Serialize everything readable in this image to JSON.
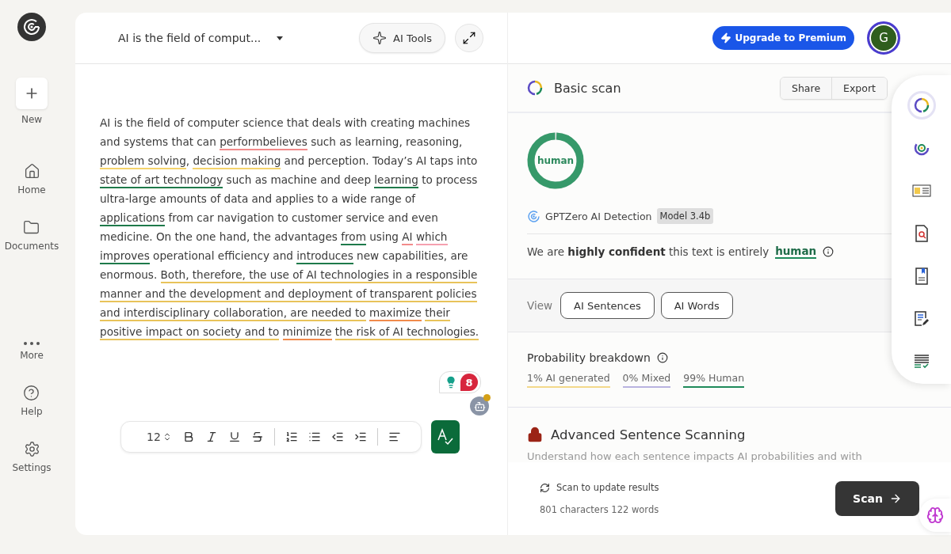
{
  "sidebar": {
    "items": [
      {
        "kind": "new",
        "label": "New"
      },
      {
        "kind": "home",
        "label": "Home"
      },
      {
        "kind": "documents",
        "label": "Documents"
      },
      {
        "kind": "more",
        "label": "More"
      },
      {
        "kind": "help",
        "label": "Help"
      },
      {
        "kind": "settings",
        "label": "Settings"
      }
    ]
  },
  "editor": {
    "title": "AI is the field of comput...",
    "ai_tools": "AI Tools",
    "segments": [
      {
        "text": "AI is the field of computer science that deals with creating machines and systems that can "
      },
      {
        "text": "performbelieves",
        "color": "#f28b8b"
      },
      {
        "text": " such as learning, reasoning, "
      },
      {
        "text": "problem solving",
        "color": "#f5d36b"
      },
      {
        "text": ", "
      },
      {
        "text": "decision making",
        "color": "#f5d36b"
      },
      {
        "text": " and perception. Today’s AI taps into "
      },
      {
        "text": "state of art technology",
        "color": "#1e7a4a"
      },
      {
        "text": " such as machine and deep "
      },
      {
        "text": "learning",
        "color": "#1e7a4a"
      },
      {
        "text": " to process ultra-large amounts of data and applies to a wide range of "
      },
      {
        "text": "applications",
        "color": "#1e7a4a"
      },
      {
        "text": " from car navigation to customer service and even medicine. On the one hand, the advantages "
      },
      {
        "text": "from",
        "color": "#1e7a4a"
      },
      {
        "text": " using "
      },
      {
        "text": "AI",
        "color": "#f28b8b"
      },
      {
        "text": " which ",
        "color": "#f5a0b0"
      },
      {
        "text": "improves",
        "color": "#1e7a4a"
      },
      {
        "text": " operational efficiency and "
      },
      {
        "text": "introduces",
        "color": "#1e7a4a"
      },
      {
        "text": " new capabilities, are enormous. "
      },
      {
        "text": "Both, therefore, the use of AI technologies in a responsible manner and the development and deployment of transparent policies and interdisciplinary collaboration, are needed to ",
        "color": "#e8c35a"
      },
      {
        "text": "maximize",
        "color": "#f08a4b"
      },
      {
        "text": " their positive impact on society and to ",
        "color": "#e8c35a"
      },
      {
        "text": "minimize",
        "color": "#f08a4b"
      },
      {
        "text": " the risk of AI technologies.",
        "color": "#e8c35a"
      }
    ],
    "suggestions_badge": "8",
    "toolbar": {
      "font_size": "12",
      "tools": [
        {
          "kind": "bold"
        },
        {
          "kind": "italic"
        },
        {
          "kind": "underline"
        },
        {
          "kind": "strikethrough"
        },
        {
          "kind": "numbered-list"
        },
        {
          "kind": "bullet-list"
        },
        {
          "kind": "outdent"
        },
        {
          "kind": "indent"
        },
        {
          "kind": "align-left"
        }
      ]
    }
  },
  "header": {
    "upgrade": "Upgrade to Premium",
    "avatar": "G"
  },
  "scan": {
    "title": "Basic scan",
    "actions": [
      "Share",
      "Export"
    ],
    "result": {
      "label": "human",
      "level": 0.99
    },
    "detector": "GPTZero AI Detection",
    "model": "Model 3.4b",
    "verdict": "We are **highly confident** this text is entirely ",
    "verdict_word": "human",
    "view_label": "View",
    "views": [
      "AI Sentences",
      "AI Words"
    ],
    "breakdown_title": "Probability breakdown",
    "breakdown": [
      {
        "label": "1% AI generated",
        "color": "#f3d98a"
      },
      {
        "label": "0% Mixed",
        "color": "#b9b3e0"
      },
      {
        "label": "99% Human",
        "color": "#1e8a5a"
      }
    ],
    "advanced_title": "Advanced Sentence Scanning",
    "advanced_text": "Understand how each sentence impacts AI probabilities and with",
    "update_note": "Scan to update results",
    "counts": "801 characters 122 words",
    "scan_button": "Scan"
  },
  "rail": [
    {
      "kind": "scan",
      "selected": true
    },
    {
      "kind": "deep",
      "selected": false
    },
    {
      "kind": "reader",
      "selected": false
    },
    {
      "kind": "plagiarism",
      "selected": false
    },
    {
      "kind": "bookmark",
      "selected": false
    },
    {
      "kind": "edit",
      "selected": false
    },
    {
      "kind": "checklist",
      "selected": false
    }
  ]
}
